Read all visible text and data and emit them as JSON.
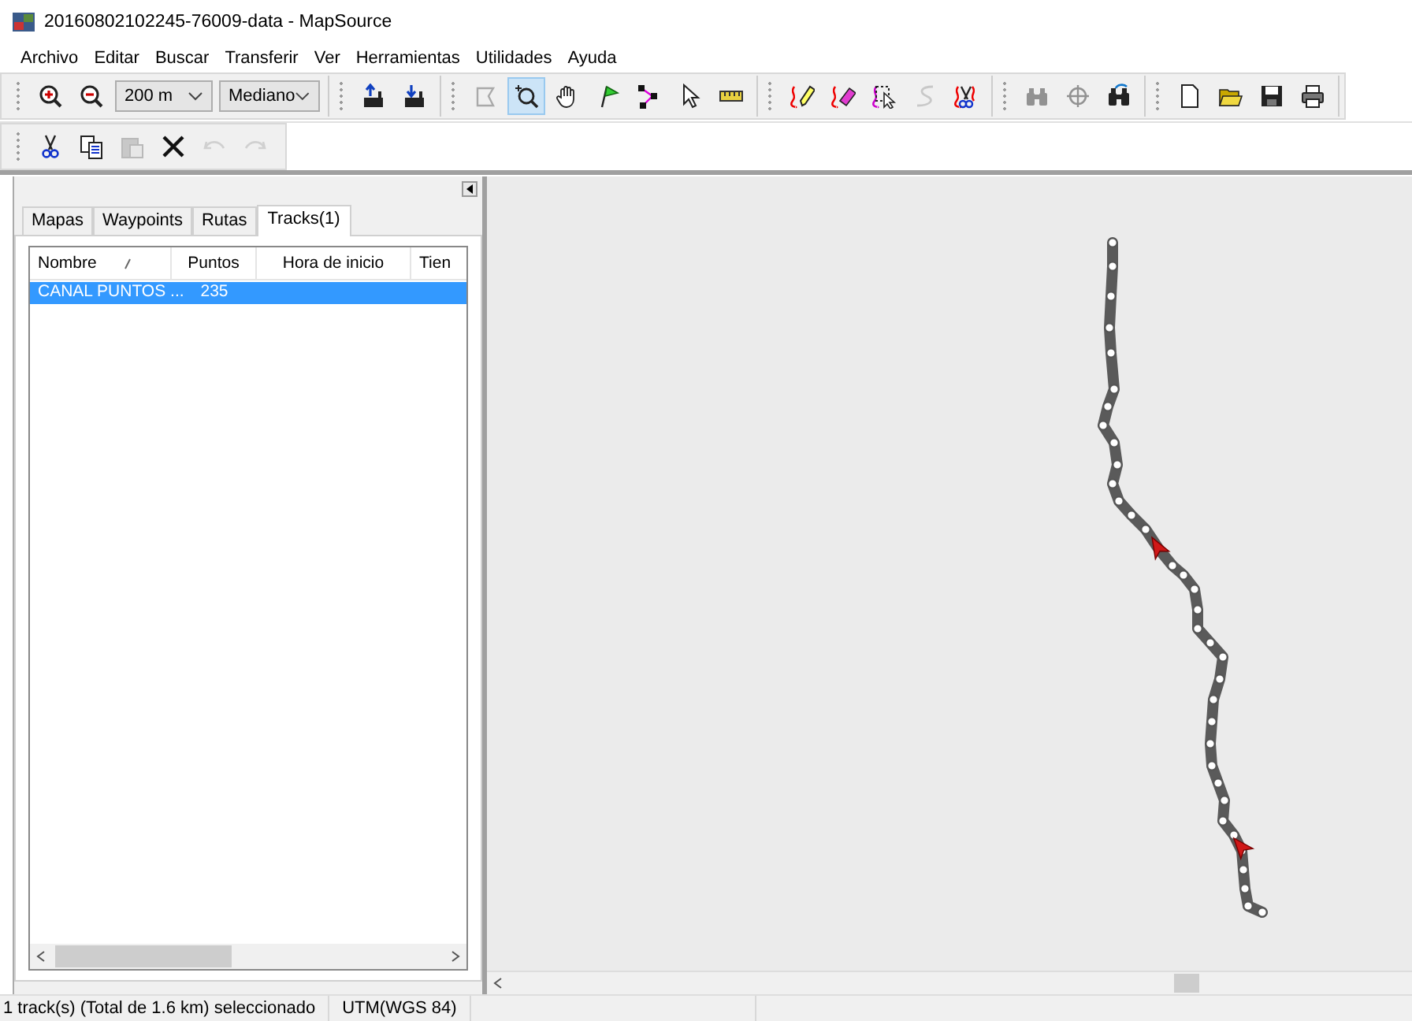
{
  "window": {
    "title": "20160802102245-76009-data - MapSource"
  },
  "menu": [
    "Archivo",
    "Editar",
    "Buscar",
    "Transferir",
    "Ver",
    "Herramientas",
    "Utilidades",
    "Ayuda"
  ],
  "toolbar_1": [
    [
      {
        "kind": "zoom-in",
        "disabled": false,
        "selected": false
      },
      {
        "kind": "zoom-out",
        "disabled": false,
        "selected": false
      },
      {
        "kind": "select",
        "value": "200 m"
      },
      {
        "kind": "select",
        "value": "Mediano"
      }
    ],
    [
      {
        "kind": "receive",
        "disabled": false,
        "selected": false
      },
      {
        "kind": "send",
        "disabled": false,
        "selected": false
      }
    ],
    [
      {
        "kind": "polygon",
        "disabled": true,
        "selected": false
      },
      {
        "kind": "zoom-tool",
        "disabled": false,
        "selected": true
      },
      {
        "kind": "hand",
        "disabled": false,
        "selected": false
      },
      {
        "kind": "flag",
        "disabled": false,
        "selected": false
      },
      {
        "kind": "route",
        "disabled": false,
        "selected": false
      },
      {
        "kind": "pointer",
        "disabled": false,
        "selected": false
      },
      {
        "kind": "ruler",
        "disabled": false,
        "selected": false
      }
    ],
    [
      {
        "kind": "pencil",
        "disabled": false,
        "selected": false
      },
      {
        "kind": "eraser",
        "disabled": false,
        "selected": false
      },
      {
        "kind": "lasso",
        "disabled": false,
        "selected": false
      },
      {
        "kind": "squiggle",
        "disabled": true,
        "selected": false
      },
      {
        "kind": "scissors-track",
        "disabled": false,
        "selected": false
      }
    ],
    [
      {
        "kind": "binoculars",
        "disabled": true,
        "selected": false
      },
      {
        "kind": "crosshair",
        "disabled": true,
        "selected": false
      },
      {
        "kind": "find-next",
        "disabled": false,
        "selected": false
      }
    ],
    [
      {
        "kind": "new",
        "disabled": false,
        "selected": false
      },
      {
        "kind": "open",
        "disabled": false,
        "selected": false
      },
      {
        "kind": "save",
        "disabled": false,
        "selected": false
      },
      {
        "kind": "print",
        "disabled": false,
        "selected": false
      }
    ]
  ],
  "toolbar_2": [
    {
      "kind": "cut",
      "disabled": false,
      "selected": false
    },
    {
      "kind": "copy",
      "disabled": false,
      "selected": false
    },
    {
      "kind": "paste",
      "disabled": true,
      "selected": false
    },
    {
      "kind": "delete",
      "disabled": false,
      "selected": false
    },
    {
      "kind": "undo",
      "disabled": true,
      "selected": false
    },
    {
      "kind": "redo",
      "disabled": true,
      "selected": false
    }
  ],
  "tabs": [
    {
      "label": "Mapas",
      "selected": false
    },
    {
      "label": "Waypoints",
      "selected": false
    },
    {
      "label": "Rutas",
      "selected": false
    },
    {
      "label": "Tracks(1)",
      "selected": true
    }
  ],
  "table": {
    "columns": [
      {
        "label": "Nombre",
        "sorted": true
      },
      {
        "label": "Puntos",
        "sorted": false
      },
      {
        "label": "Hora de inicio",
        "sorted": false
      },
      {
        "label": "Tien",
        "sorted": false
      }
    ],
    "rows": [
      {
        "cells": [
          "CANAL PUNTOS ...",
          "235"
        ],
        "selected": true
      }
    ]
  },
  "status_bar": [
    "1 track(s) (Total de 1.6 km) seleccionado",
    "UTM(WGS 84)"
  ]
}
